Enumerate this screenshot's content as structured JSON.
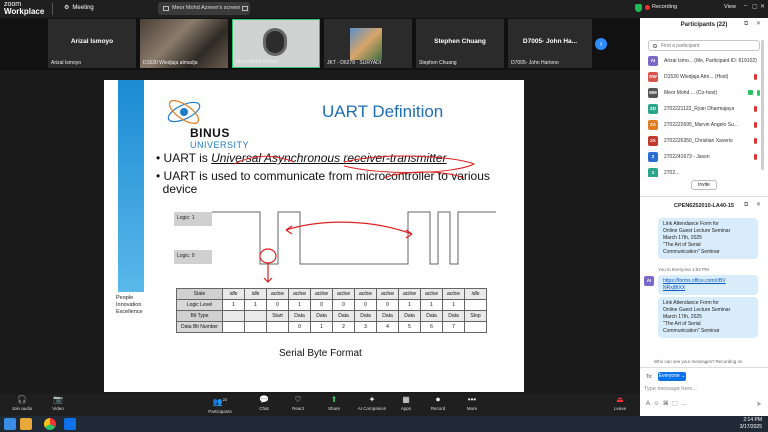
{
  "app": {
    "name_top": "zoom",
    "name_bottom": "Workplace"
  },
  "topbar": {
    "meeting_label": "Meeting",
    "screen_share_label": "Meor Mohd Azreen's screen"
  },
  "strip": {
    "tiles": [
      {
        "center": "Arizal Ismoyo",
        "foot": "Arizal Ismoyo"
      },
      {
        "center": "",
        "foot": "D1530 Wiedjaja atmadja"
      },
      {
        "center": "",
        "foot": "Meor Mohd Azreen"
      },
      {
        "center": "",
        "foot": "JKT - D6278 - SURYADI"
      },
      {
        "center": "Stephen Chuang",
        "foot": "Stephen Chuang"
      },
      {
        "center": "D7005- John Ha...",
        "foot": "D7005- John Hartono"
      }
    ]
  },
  "slide": {
    "title": "UART Definition",
    "logo_main": "BINUS",
    "logo_sub": "UNIVERSITY",
    "bullet1_pre": "UART is ",
    "bullet1_em": "Universal Asynchronous receiver-transmitter",
    "bullet2_line1": "UART is used to communicate from microcontroller to various",
    "bullet2_line2": "device",
    "motto": [
      "People",
      "Innovation",
      "Excellence"
    ],
    "logic1": "Logic: 1",
    "logic0": "Logic: 0",
    "caption": "Serial Byte Format",
    "table": {
      "state": {
        "label": "State",
        "cells": [
          "idle",
          "idle",
          "active",
          "active",
          "active",
          "active",
          "active",
          "active",
          "active",
          "active",
          "active",
          "idle"
        ]
      },
      "level": {
        "label": "Logic Level",
        "cells": [
          "1",
          "1",
          "0",
          "1",
          "0",
          "0",
          "0",
          "0",
          "1",
          "1",
          "1",
          ""
        ]
      },
      "type": {
        "label": "Bit Type",
        "cells": [
          "",
          "",
          "Start",
          "Data",
          "Data",
          "Data",
          "Data",
          "Data",
          "Data",
          "Data",
          "Data",
          "Stop"
        ]
      },
      "number": {
        "label": "Data Bit Number",
        "cells": [
          "",
          "",
          "",
          "0",
          "1",
          "2",
          "3",
          "4",
          "5",
          "6",
          "7",
          ""
        ]
      }
    }
  },
  "panel": {
    "title": "Participants (22)",
    "search_placeholder": "Find a participant",
    "participants": [
      {
        "initials": "AI",
        "name": "Arizal Ismo... (Me, Participant ID: 619102)",
        "color": "#7b68c8"
      },
      {
        "initials": "DW",
        "name": "D1530 Wiedjaja Atm... (Host)",
        "color": "#d9534f"
      },
      {
        "initials": "MM",
        "name": "Meor Mohd ... (Co-host)",
        "color": "#555555"
      },
      {
        "initials": "ZD",
        "name": "2702221122_Ryan Dharmajaya",
        "color": "#2ca58d"
      },
      {
        "initials": "ZA",
        "name": "2702222695_Marvin Angelo Su...",
        "color": "#e07b1f"
      },
      {
        "initials": "2X",
        "name": "2702226350_Christian Xaverio",
        "color": "#c0392b"
      },
      {
        "initials": "2",
        "name": "2702241673 - Jason",
        "color": "#2d6fd1"
      },
      {
        "initials": "2",
        "name": "2702...",
        "color": "#2ca58d"
      }
    ],
    "invite_label": "Invite",
    "chat_title": "CPEN6252010-LA40-15",
    "chat": {
      "msg1": [
        "Link Attendance Form for",
        "Online Guest Lecture Seminar",
        "March 17th, 2025",
        "\"The Art of Serial",
        "Communication\" Seminar"
      ],
      "meta": "You to Everyone 1:52 PM",
      "avatar": "AI",
      "link": [
        "https://forms.office.com/r/BV",
        "NRxjBtXX"
      ],
      "msg2": [
        "Link Attendance Form for",
        "Online Guest Lecture Seminar",
        "March 17th, 2025",
        "\"The Art of Serial",
        "Communication\" Seminar"
      ],
      "who_see": "Who can see your messages? Recording on",
      "to_label": "To:",
      "to_value": "Everyone",
      "input_placeholder": "Type message here..."
    }
  },
  "toolbar": {
    "items": [
      {
        "icon": "🎧",
        "label": "Join audio"
      },
      {
        "icon": "📷",
        "label": "Video"
      },
      {
        "icon": "👥",
        "label": "Participants"
      },
      {
        "icon": "💬",
        "label": "Chat"
      },
      {
        "icon": "♡",
        "label": "React"
      },
      {
        "icon": "⬆",
        "label": "Share"
      },
      {
        "icon": "✦",
        "label": "AI Companion"
      },
      {
        "icon": "▦",
        "label": "Apps"
      },
      {
        "icon": "⏺",
        "label": "Record"
      },
      {
        "icon": "•••",
        "label": "More"
      },
      {
        "icon": "⏏",
        "label": "Leave"
      }
    ],
    "participant_count": "22"
  },
  "header_right": {
    "recording": "Recording",
    "view": "View"
  },
  "taskbar": {
    "time": "2:14 PM",
    "date": "3/17/2025"
  }
}
